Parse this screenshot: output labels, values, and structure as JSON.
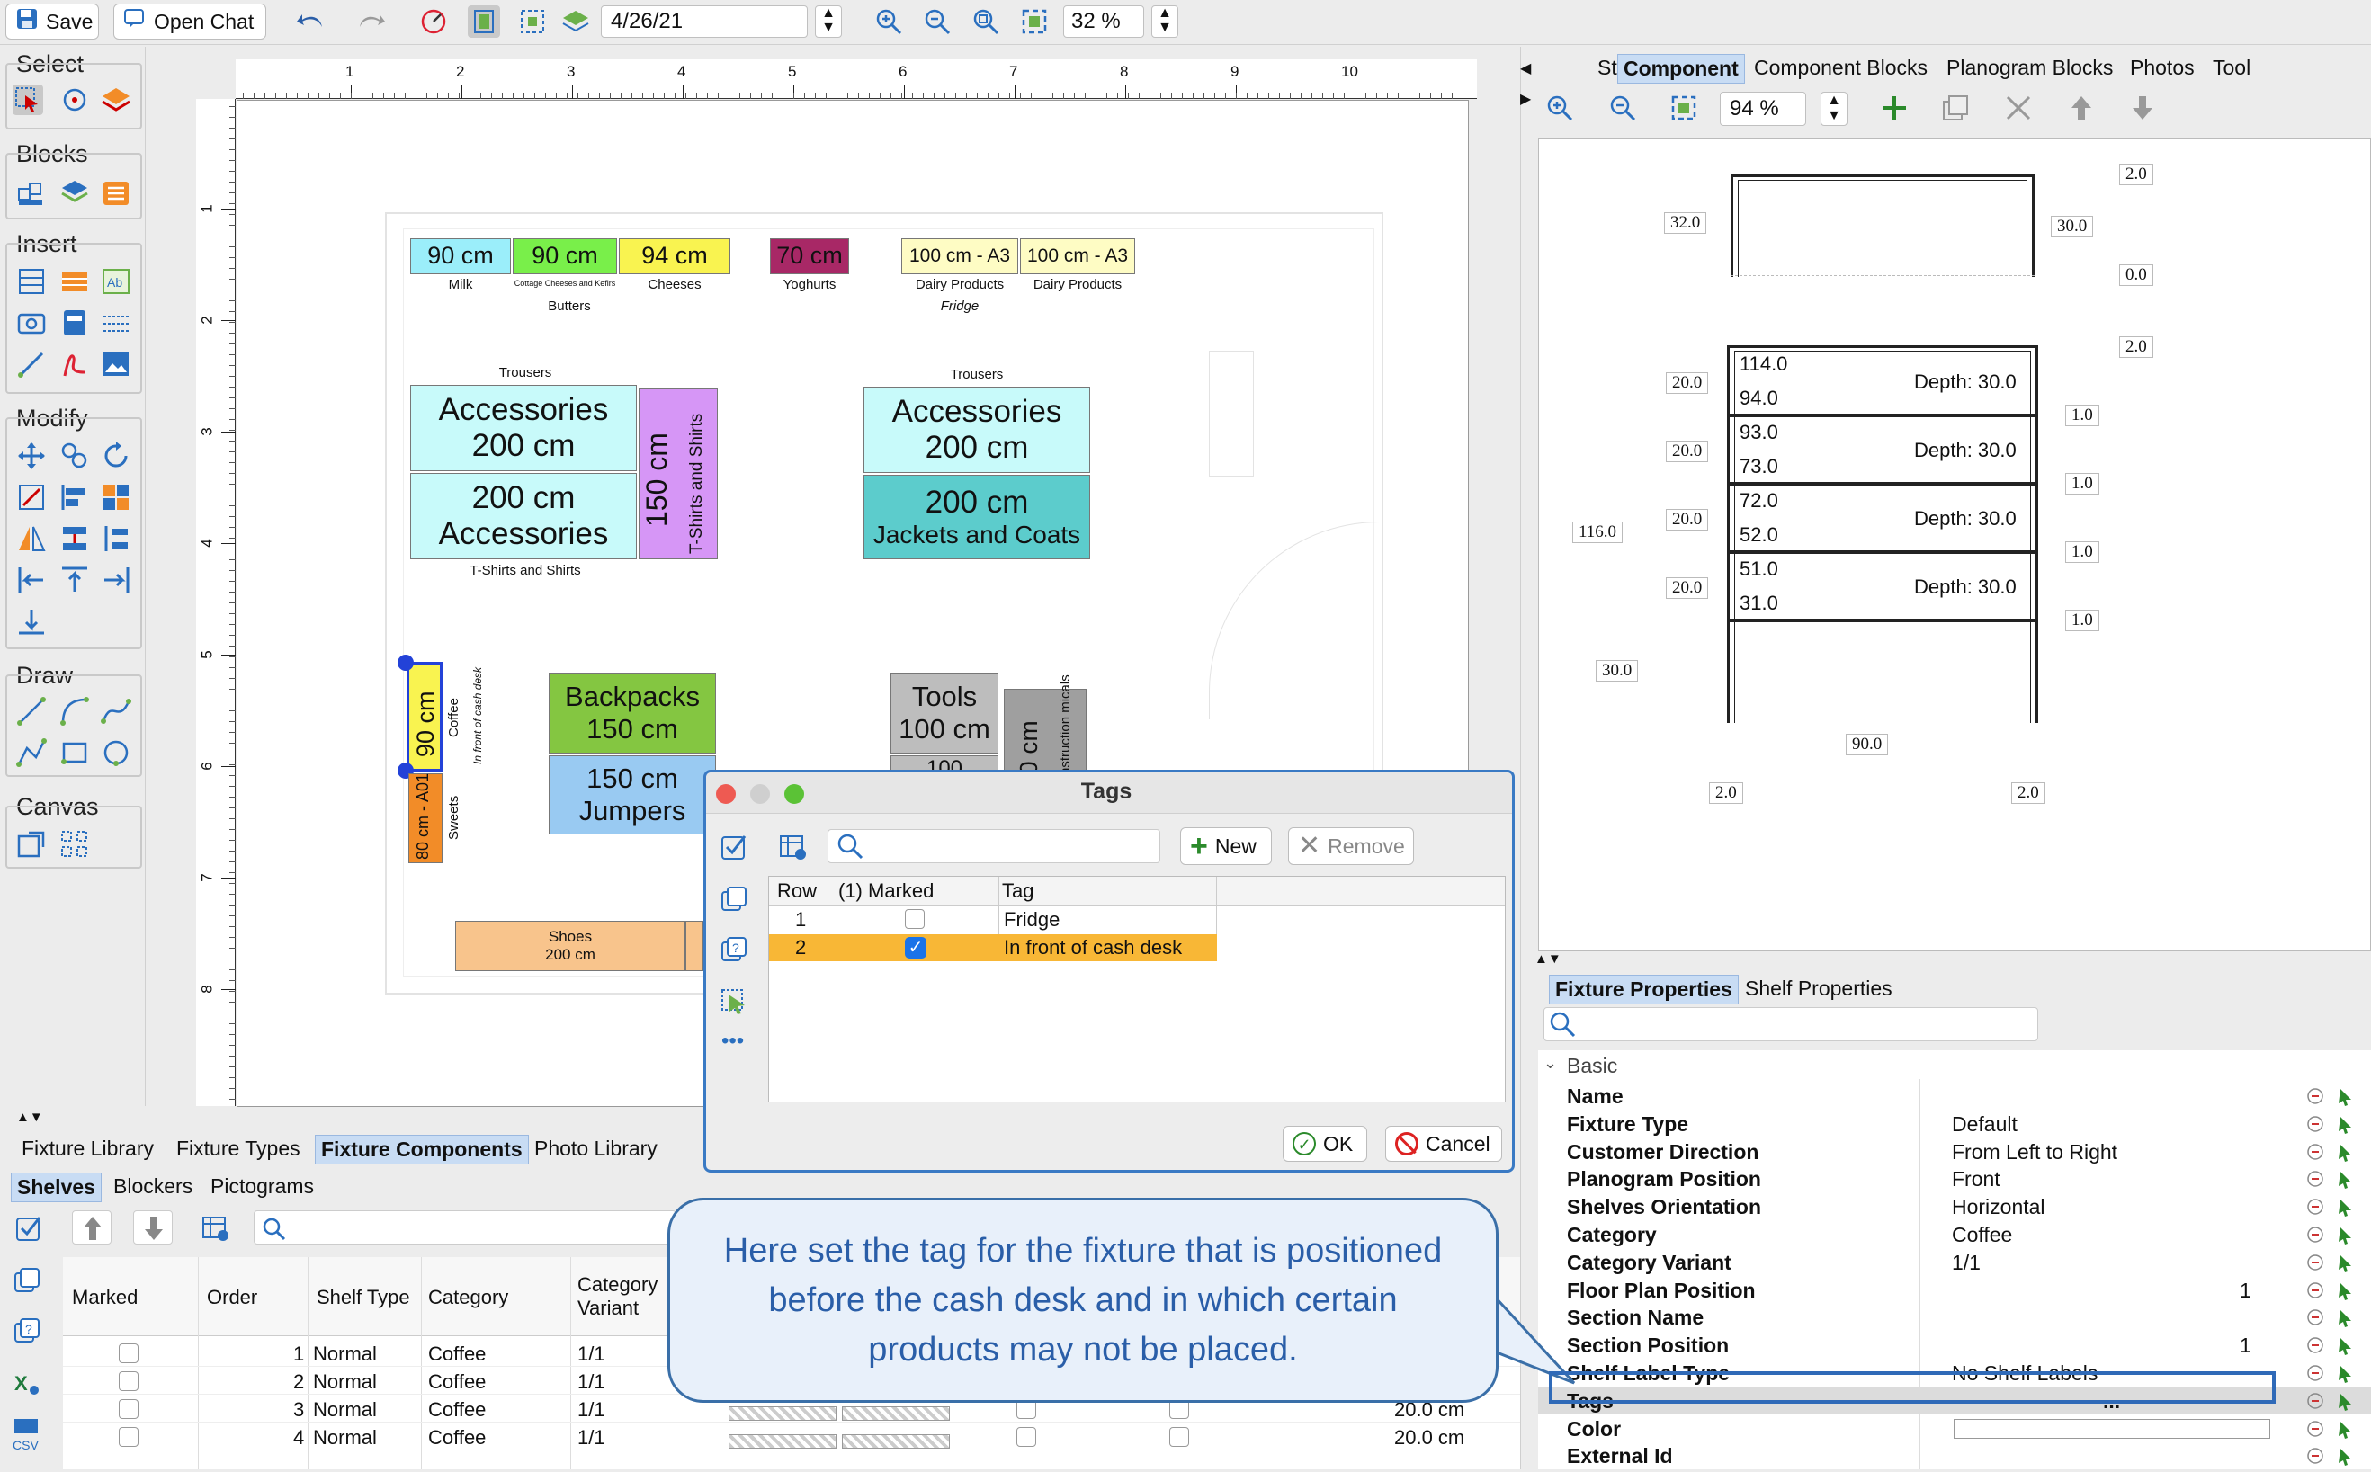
{
  "toolbar": {
    "save_label": "Save",
    "open_chat_label": "Open Chat",
    "date_value": "4/26/21",
    "zoom_value": "32 %"
  },
  "left_palette": {
    "select_title": "Select",
    "blocks_title": "Blocks",
    "insert_title": "Insert",
    "modify_title": "Modify",
    "draw_title": "Draw",
    "canvas_title": "Canvas"
  },
  "ruler": {
    "h_ticks": [
      "1",
      "2",
      "3",
      "4",
      "5",
      "6",
      "7",
      "8",
      "9",
      "10"
    ],
    "v_ticks": [
      "1",
      "2",
      "3",
      "4",
      "5",
      "6",
      "7",
      "8"
    ]
  },
  "floor": {
    "milk": {
      "size": "90 cm",
      "name": "Milk"
    },
    "butters": {
      "size": "90 cm",
      "name": "Butters",
      "sub": "Cottage Cheeses and Kefirs"
    },
    "cheeses": {
      "size": "94 cm",
      "name": "Cheeses"
    },
    "yoghurts": {
      "size": "70 cm",
      "name": "Yoghurts"
    },
    "dairy1": {
      "size": "100 cm - A3",
      "name": "Dairy Products"
    },
    "dairy2": {
      "size": "100 cm - A3",
      "name": "Dairy Products"
    },
    "fridge_label": "Fridge",
    "trousers1": "Trousers",
    "trousers2": "Trousers",
    "acc1": {
      "name": "Accessories",
      "size": "200 cm"
    },
    "acc2": {
      "size": "200 cm",
      "name": "Accessories"
    },
    "tshirts_label": "T-Shirts and Shirts",
    "tshirts_v": {
      "size": "150 cm",
      "name": "T-Shirts and Shirts"
    },
    "acc3": {
      "name": "Accessories",
      "size": "200 cm"
    },
    "jackets": {
      "size": "200 cm",
      "name": "Jackets and Coats"
    },
    "coffee": {
      "size": "90 cm",
      "name": "Coffee",
      "note": "In front of cash desk"
    },
    "sweets": {
      "size": "80 cm - A01",
      "name": "Sweets"
    },
    "backpacks": {
      "name": "Backpacks",
      "size": "150 cm"
    },
    "jumpers": {
      "size": "150 cm",
      "name": "Jumpers"
    },
    "tools": {
      "name": "Tools",
      "size": "100 cm"
    },
    "tools2": "100",
    "construction": {
      "size": "0 cm",
      "name": "nstruction micals"
    },
    "shoes": {
      "name": "Shoes",
      "size": "200 cm"
    }
  },
  "bottom_tabs": {
    "tab1": "Fixture Library",
    "tab2": "Fixture Types",
    "tab3": "Fixture Components",
    "tab4": "Photo Library",
    "sub1": "Shelves",
    "sub2": "Blockers",
    "sub3": "Pictograms"
  },
  "shelves_table": {
    "headers": [
      "Marked",
      "Order",
      "Shelf Type",
      "Category",
      "Category Variant"
    ],
    "rows": [
      {
        "order": "1",
        "type": "Normal",
        "category": "Coffee",
        "variant": "1/1",
        "height": ""
      },
      {
        "order": "2",
        "type": "Normal",
        "category": "Coffee",
        "variant": "1/1",
        "height": ""
      },
      {
        "order": "3",
        "type": "Normal",
        "category": "Coffee",
        "variant": "1/1",
        "height": "20.0 cm"
      },
      {
        "order": "4",
        "type": "Normal",
        "category": "Coffee",
        "variant": "1/1",
        "height": "20.0 cm"
      }
    ]
  },
  "right_tabs": {
    "store": "Store",
    "component": "Component",
    "component_blocks": "Component Blocks",
    "planogram_blocks": "Planogram Blocks",
    "photos": "Photos",
    "tool": "Tool",
    "zoom": "94 %"
  },
  "fixture_drawing": {
    "top": {
      "w_right": "2.0",
      "left": "32.0",
      "right": "30.0",
      "bottom_right": "0.0"
    },
    "shelves": [
      {
        "top": "114.0",
        "bottom": "94.0",
        "depth": "Depth: 30.0",
        "left": "20.0",
        "right": "1.0"
      },
      {
        "top": "93.0",
        "bottom": "73.0",
        "depth": "Depth: 30.0",
        "left": "20.0",
        "right": "1.0"
      },
      {
        "top": "72.0",
        "bottom": "52.0",
        "depth": "Depth: 30.0",
        "left": "20.0",
        "right": "1.0"
      },
      {
        "top": "51.0",
        "bottom": "31.0",
        "depth": "Depth: 30.0",
        "left": "20.0",
        "right": "1.0"
      }
    ],
    "frame_right_top": "2.0",
    "total_height": "116.0",
    "base": "30.0",
    "width": "90.0",
    "foot_left": "2.0",
    "foot_right": "2.0"
  },
  "properties": {
    "tab1": "Fixture Properties",
    "tab2": "Shelf Properties",
    "group": "Basic",
    "rows": [
      {
        "k": "Name",
        "v": ""
      },
      {
        "k": "Fixture Type",
        "v": "Default"
      },
      {
        "k": "Customer Direction",
        "v": "From Left to Right"
      },
      {
        "k": "Planogram Position",
        "v": "Front"
      },
      {
        "k": "Shelves Orientation",
        "v": "Horizontal"
      },
      {
        "k": "Category",
        "v": "Coffee"
      },
      {
        "k": "Category Variant",
        "v": "1/1"
      },
      {
        "k": "Floor Plan Position",
        "v": "1"
      },
      {
        "k": "Section Name",
        "v": ""
      },
      {
        "k": "Section Position",
        "v": "1"
      },
      {
        "k": "Shelf Label Type",
        "v": "No Shelf Labels"
      },
      {
        "k": "Tags",
        "v": "..."
      },
      {
        "k": "Color",
        "v": ""
      },
      {
        "k": "External Id",
        "v": ""
      }
    ]
  },
  "tags_dialog": {
    "title": "Tags",
    "new_label": "New",
    "remove_label": "Remove",
    "headers": [
      "Row",
      "(1) Marked",
      "Tag"
    ],
    "rows": [
      {
        "row": "1",
        "marked": false,
        "tag": "Fridge"
      },
      {
        "row": "2",
        "marked": true,
        "tag": "In front of cash desk"
      }
    ],
    "ok_label": "OK",
    "cancel_label": "Cancel"
  },
  "callout": {
    "text": "Here set the tag for the fixture that is positioned before the cash desk and in which certain products may not be placed."
  }
}
